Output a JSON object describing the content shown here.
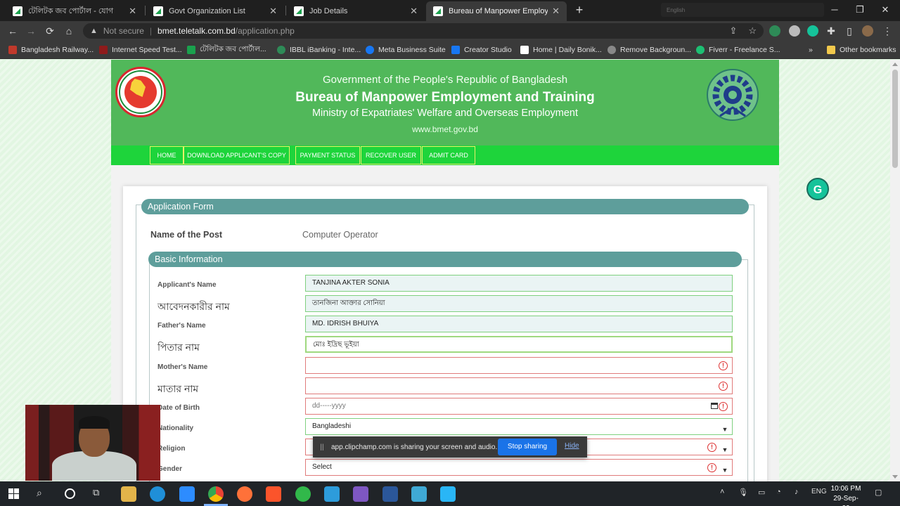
{
  "browser": {
    "tabs": [
      {
        "label": "টেলিটক জব পোর্টাল - যোগ",
        "active": false
      },
      {
        "label": "Govt Organization List",
        "active": false
      },
      {
        "label": "Job Details",
        "active": false
      },
      {
        "label": "Bureau of Manpower Employmen",
        "active": true
      }
    ],
    "new_tab": "+",
    "address": {
      "security": "Not secure",
      "separator": "|",
      "host": "bmet.teletalk.com.bd",
      "path": "/application.php"
    },
    "bookmarks": [
      {
        "label": "Bangladesh Railway...",
        "color": "#c0392b"
      },
      {
        "label": "Internet Speed Test...",
        "color": "#8e1b1b"
      },
      {
        "label": "টেলিটক জব পোর্টাল...",
        "color": "#1aa14d"
      },
      {
        "label": "IBBL iBanking - Inte...",
        "color": "#2e8b57"
      },
      {
        "label": "Meta Business Suite",
        "color": "#1877f2"
      },
      {
        "label": "Creator Studio",
        "color": "#1877f2"
      },
      {
        "label": "Home | Daily Bonik...",
        "color": "#ffffff"
      },
      {
        "label": "Remove Backgroun...",
        "color": "#888888"
      },
      {
        "label": "Fiverr - Freelance S...",
        "color": "#1dbf73"
      }
    ],
    "bookmarks_more": "»",
    "other_bookmarks": "Other bookmarks",
    "ext_strip_label": "English"
  },
  "header": {
    "line1": "Government of the People's Republic of Bangladesh",
    "line2": "Bureau of Manpower Employment and Training",
    "line3": "Ministry of Expatriates' Welfare and Overseas Employment",
    "line4": "www.bmet.gov.bd"
  },
  "nav": [
    "HOME",
    "DOWNLOAD APPLICANT'S COPY",
    "PAYMENT STATUS",
    "RECOVER USER",
    "ADMIT CARD"
  ],
  "form": {
    "section_title": "Application Form",
    "post_label": "Name of the Post",
    "post_value": "Computer Operator",
    "basic_title": "Basic Information",
    "fields": [
      {
        "label": "Applicant's Name",
        "value": "TANJINA AKTER SONIA",
        "bn": false
      },
      {
        "label": "আবেদনকারীর নাম",
        "value": "তানজিনা আক্তার সোনিয়া",
        "bn": true
      },
      {
        "label": "Father's Name",
        "value": "MD. IDRISH BHUIYA",
        "bn": false
      },
      {
        "label": "পিতার নাম",
        "value": "মোঃ ইদ্রিছ ভূইয়া",
        "bn": true
      },
      {
        "label": "Mother's Name",
        "value": "",
        "bn": false
      },
      {
        "label": "মাতার নাম",
        "value": "",
        "bn": true
      },
      {
        "label": "Date of Birth",
        "value": "dd-----yyyy",
        "bn": false
      },
      {
        "label": "Nationality",
        "value": "Bangladeshi",
        "bn": false
      },
      {
        "label": "Religion",
        "value": "",
        "bn": false
      },
      {
        "label": "Gender",
        "value": "Select",
        "bn": false
      }
    ]
  },
  "share_banner": {
    "grip": "||",
    "message": "app.clipchamp.com is sharing your screen and audio.",
    "stop": "Stop sharing",
    "hide": "Hide"
  },
  "grammarly": "G",
  "taskbar": {
    "time": "10:06 PM",
    "date": "29-Sep-22",
    "lang": "ENG"
  }
}
